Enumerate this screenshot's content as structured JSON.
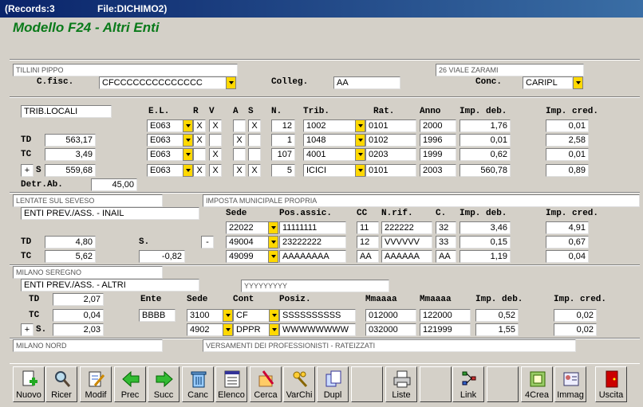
{
  "titlebar": {
    "records": "(Records:3",
    "file": "File:DICHIMO2)"
  },
  "form_title": "Modello F24 - Altri Enti",
  "header": {
    "name": "TILLINI PIPPO",
    "address": "26 VIALE ZARAMI",
    "cfisc_label": "C.fisc.",
    "cfisc_value": "CFCCCCCCCCCCCCCC",
    "colleg_label": "Colleg.",
    "colleg_value": "AA",
    "conc_label": "Conc.",
    "conc_value": "CARIPL"
  },
  "erario": {
    "title": "TRIB.LOCALI",
    "headers": {
      "el": "E.L.",
      "r": "R",
      "v": "V",
      "a": "A",
      "s": "S",
      "n": "N.",
      "trib": "Trib.",
      "rat": "Rat.",
      "anno": "Anno",
      "deb": "Imp. deb.",
      "cred": "Imp. cred."
    },
    "td_label": "TD",
    "td_value": "563,17",
    "tc_label": "TC",
    "tc_value": "3,49",
    "plus": "+",
    "s_label": "S",
    "s_value": "559,68",
    "detr_label": "Detr.Ab.",
    "detr_value": "45,00",
    "rows": [
      {
        "el": "E063",
        "r": "X",
        "v": "X",
        "a": "",
        "s": "X",
        "n": "12",
        "trib": "1002",
        "rat": "0101",
        "anno": "2000",
        "deb": "1,76",
        "cred": "0,01"
      },
      {
        "el": "E063",
        "r": "X",
        "v": "",
        "a": "X",
        "s": "",
        "n": "1",
        "trib": "1048",
        "rat": "0102",
        "anno": "1996",
        "deb": "0,01",
        "cred": "2,58"
      },
      {
        "el": "E063",
        "r": "",
        "v": "X",
        "a": "",
        "s": "",
        "n": "107",
        "trib": "4001",
        "rat": "0203",
        "anno": "1999",
        "deb": "0,62",
        "cred": "0,01"
      },
      {
        "el": "E063",
        "r": "X",
        "v": "X",
        "a": "X",
        "s": "X",
        "n": "5",
        "trib": "ICICI",
        "rat": "0101",
        "anno": "2003",
        "deb": "560,78",
        "cred": "0,89"
      }
    ]
  },
  "inail": {
    "place": "LENTATE SUL SEVESO",
    "imu": "IMPOSTA MUNICIPALE PROPRIA",
    "title": "ENTI PREV./ASS. - INAIL",
    "headers": {
      "sede": "Sede",
      "pos": "Pos.assic.",
      "cc": "CC",
      "nrif": "N.rif.",
      "c": "C.",
      "deb": "Imp. deb.",
      "cred": "Imp. cred."
    },
    "td_label": "TD",
    "td_value": "4,80",
    "s_label": "S.",
    "s_sign": "-",
    "tc_label": "TC",
    "tc_value": "5,62",
    "s_value": "-0,82",
    "rows": [
      {
        "sede": "22022",
        "pos": "11111111",
        "cc": "11",
        "nrif": "222222",
        "c": "32",
        "deb": "3,46",
        "cred": "4,91"
      },
      {
        "sede": "49004",
        "pos": "23222222",
        "cc": "12",
        "nrif": "VVVVVV",
        "c": "33",
        "deb": "0,15",
        "cred": "0,67"
      },
      {
        "sede": "49099",
        "pos": "AAAAAAAA",
        "cc": "AA",
        "nrif": "AAAAAA",
        "c": "AA",
        "deb": "1,19",
        "cred": "0,04"
      }
    ]
  },
  "altri": {
    "place": "MILANO SEREGNO",
    "title": "ENTI PREV./ASS. - ALTRI",
    "extra": "YYYYYYYYY",
    "headers": {
      "ente": "Ente",
      "sede": "Sede",
      "cont": "Cont",
      "pos": "Posiz.",
      "m1": "Mmaaaa",
      "m2": "Mmaaaa",
      "deb": "Imp. deb.",
      "cred": "Imp. cred."
    },
    "td_label": "TD",
    "td_value": "2,07",
    "tc_label": "TC",
    "tc_value": "0,04",
    "plus": "+",
    "s_label": "S.",
    "s_value": "2,03",
    "rows": [
      {
        "ente": "BBBB",
        "sede": "3100",
        "cont": "CF",
        "pos": "SSSSSSSSSS",
        "m1": "012000",
        "m2": "122000",
        "deb": "0,52",
        "cred": "0,02"
      },
      {
        "ente": "",
        "sede": "4902",
        "cont": "DPPR",
        "pos": "WWWWWWWW",
        "m1": "032000",
        "m2": "121999",
        "deb": "1,55",
        "cred": "0,02"
      }
    ]
  },
  "footer": {
    "place": "MILANO NORD",
    "versamenti": "VERSAMENTI DEI PROFESSIONISTI - RATEIZZATI"
  },
  "toolbar": [
    {
      "label": "Nuovo",
      "icon": "new-doc-icon"
    },
    {
      "label": "Ricer",
      "icon": "search-icon"
    },
    {
      "label": "Modif",
      "icon": "edit-icon"
    },
    {
      "label": "Prec",
      "icon": "arrow-left-icon"
    },
    {
      "label": "Succ",
      "icon": "arrow-right-icon"
    },
    {
      "label": "Canc",
      "icon": "trash-icon"
    },
    {
      "label": "Elenco",
      "icon": "list-icon"
    },
    {
      "label": "Cerca",
      "icon": "find-icon"
    },
    {
      "label": "VarChi",
      "icon": "keys-icon"
    },
    {
      "label": "Dupl",
      "icon": "duplicate-icon"
    },
    {
      "label": "",
      "icon": ""
    },
    {
      "label": "Liste",
      "icon": "printer-icon"
    },
    {
      "label": "",
      "icon": ""
    },
    {
      "label": "Link",
      "icon": "link-icon"
    },
    {
      "label": "",
      "icon": ""
    },
    {
      "label": "4Crea",
      "icon": "create-icon"
    },
    {
      "label": "Immag",
      "icon": "image-icon"
    },
    {
      "label": "",
      "icon": ""
    },
    {
      "label": "Uscita",
      "icon": "exit-door-icon"
    }
  ],
  "colors": {
    "title_green": "#0a7a1a",
    "dropdown_yellow": "#ffd800",
    "titlebar": "#0a246a"
  }
}
